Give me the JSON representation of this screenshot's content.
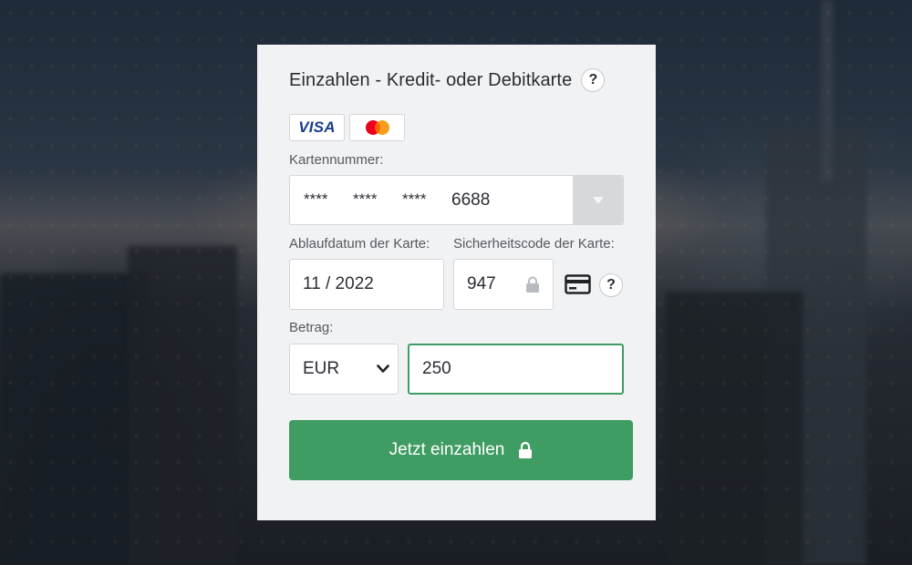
{
  "form": {
    "title": "Einzahlen - Kredit- oder Debitkarte",
    "help_symbol": "?",
    "brands": {
      "visa": "VISA",
      "mastercard_icon": "mastercard-logo"
    },
    "card_number": {
      "label": "Kartennummer:",
      "masked_groups": [
        "****",
        "****",
        "****"
      ],
      "last_digits": "6688"
    },
    "expiry": {
      "label": "Ablaufdatum der Karte:",
      "value": "11 / 2022"
    },
    "cvv": {
      "label": "Sicherheitscode der Karte:",
      "value": "947"
    },
    "amount": {
      "label": "Betrag:",
      "currency": "EUR",
      "value": "250"
    },
    "submit_label": "Jetzt einzahlen"
  },
  "colors": {
    "accent_green": "#3f9c63",
    "focus_border": "#3f9c63",
    "visa_blue": "#1a3d8f",
    "mc_red": "#eb001b",
    "mc_orange": "#f79e1b"
  }
}
